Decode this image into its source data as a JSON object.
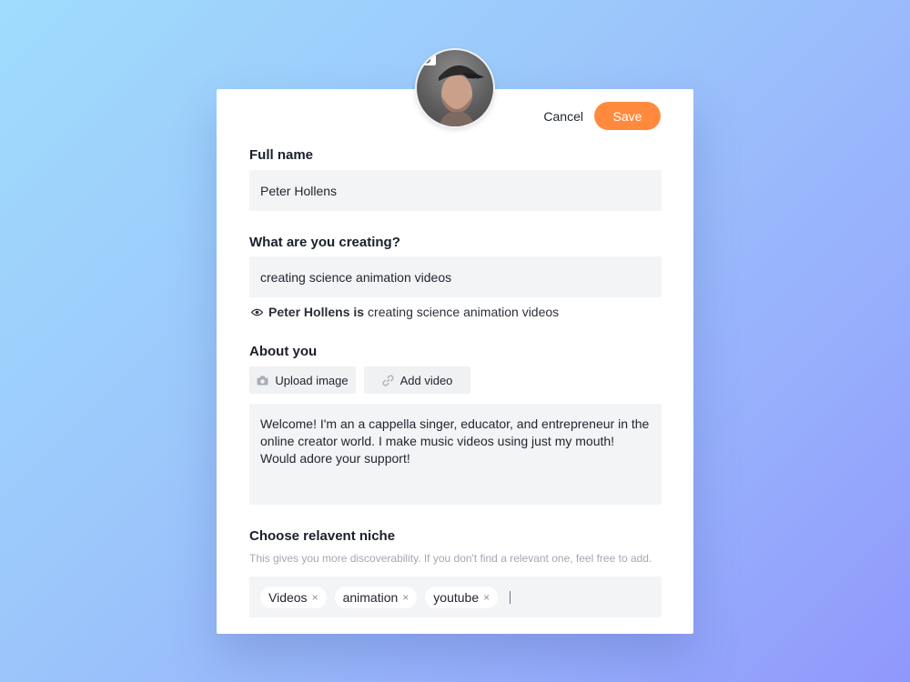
{
  "actions": {
    "cancel": "Cancel",
    "save": "Save"
  },
  "colors": {
    "accent": "#ff8a3d",
    "field_bg": "#f3f4f6"
  },
  "avatar": {
    "icon": "camera-icon"
  },
  "full_name": {
    "label": "Full name",
    "value": "Peter Hollens"
  },
  "creating": {
    "label": "What are you creating?",
    "value": "creating science animation videos",
    "preview_name": "Peter Hollens is",
    "preview_text": "creating science animation videos"
  },
  "about": {
    "label": "About you",
    "upload_image": "Upload image",
    "add_video": "Add video",
    "bio": "Welcome! I'm an a cappella singer, educator, and entrepreneur in the online creator world. I make music videos using just my mouth! Would adore your support!"
  },
  "niche": {
    "label": "Choose relavent niche",
    "hint": "This gives you more discoverability. If you don't find a relevant one, feel free to add.",
    "tags": [
      "Videos",
      "animation",
      "youtube"
    ],
    "remove_symbol": "×"
  }
}
